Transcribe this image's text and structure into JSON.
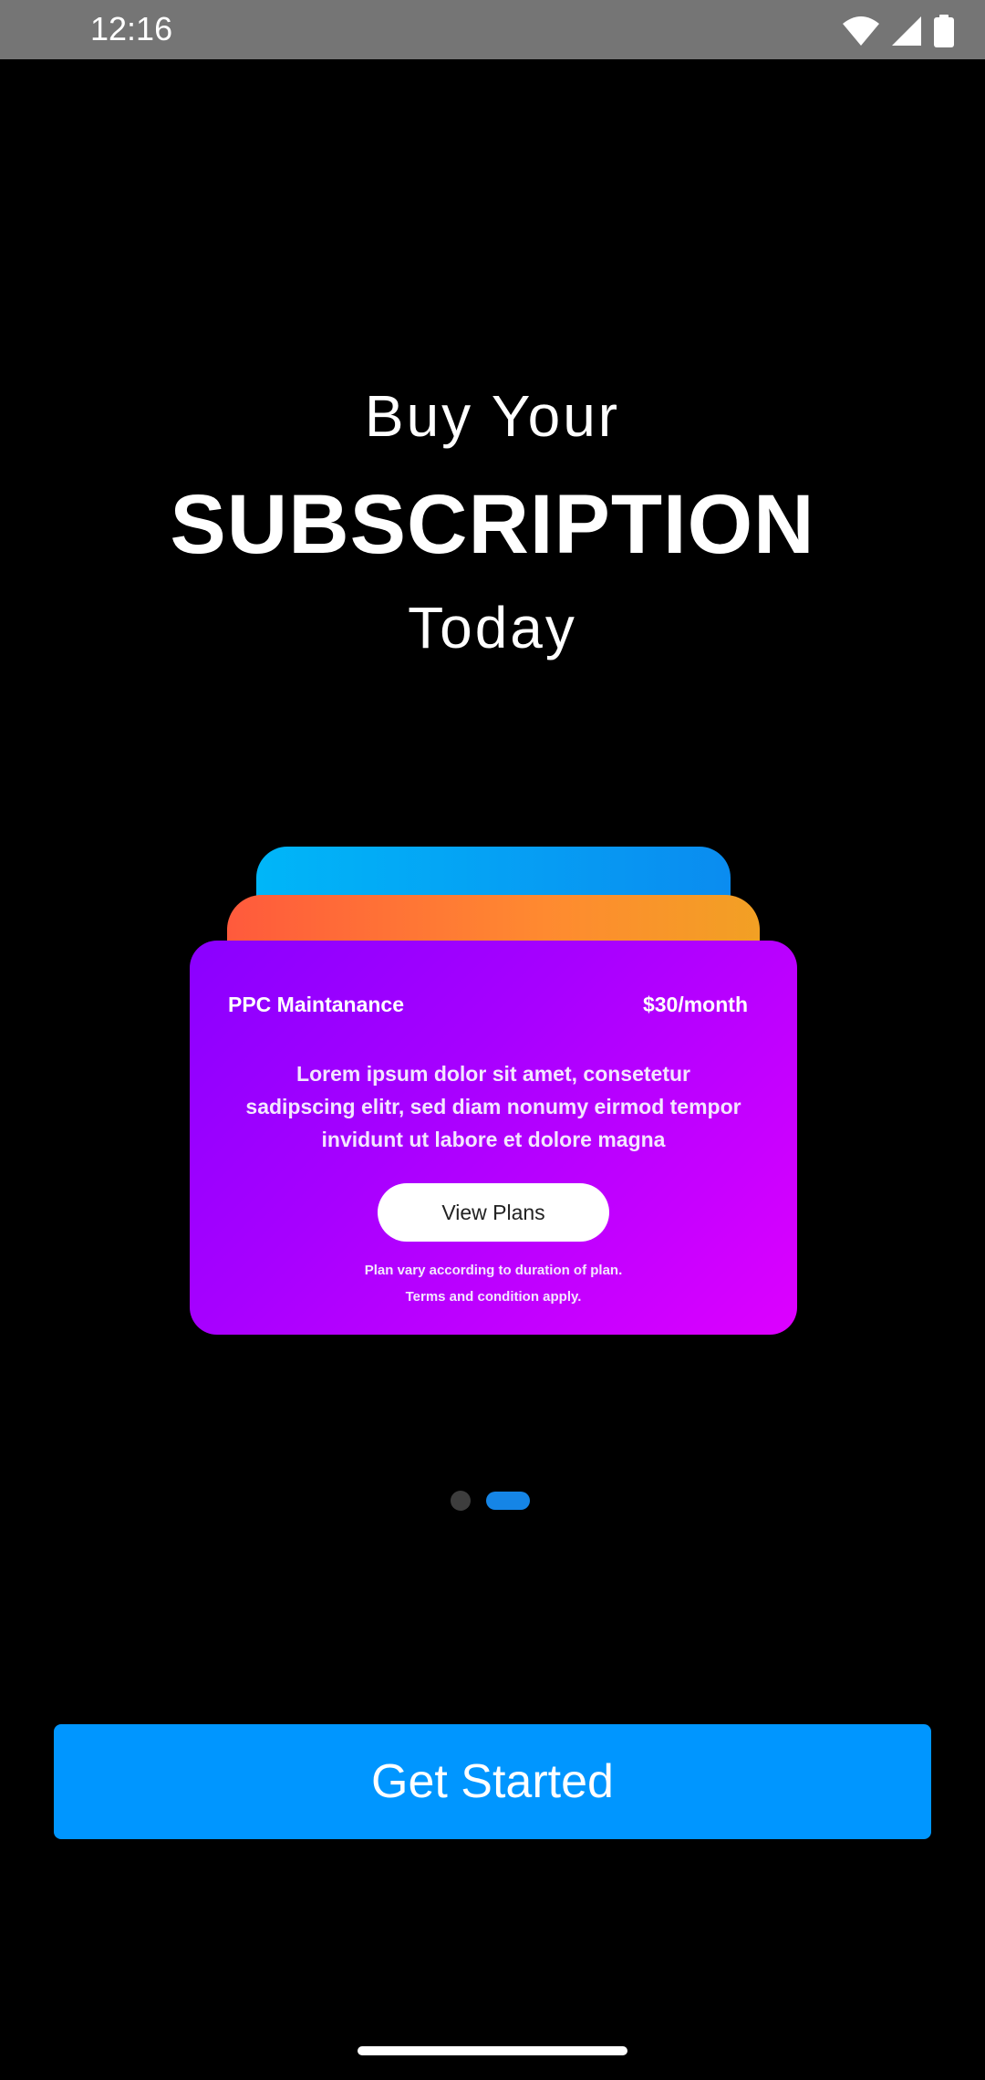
{
  "status_bar": {
    "time": "12:16",
    "icons": [
      "wifi-icon",
      "cellular-signal-icon",
      "battery-icon"
    ],
    "background": "#757575"
  },
  "heading": {
    "line1": "Buy Your",
    "line2": "SUBSCRIPTION",
    "line3": "Today"
  },
  "card": {
    "title": "PPC Maintanance",
    "price": "$30/month",
    "description": "Lorem ipsum dolor sit amet, consetetur sadipscing elitr, sed diam nonumy eirmod tempor invidunt ut labore et dolore magna",
    "button_label": "View Plans",
    "note_line1": "Plan vary according to duration of plan.",
    "note_line2": "Terms and condition apply."
  },
  "pager": {
    "pages": 2,
    "active_index": 1
  },
  "cta": {
    "label": "Get Started",
    "color": "#0096ff"
  },
  "colors": {
    "background": "#000000",
    "card_front_gradient": [
      "#8a00ff",
      "#dd00ff"
    ],
    "card_middle_gradient": [
      "#ff5a3c",
      "#f2a024"
    ],
    "card_back_gradient": [
      "#00b6f8",
      "#0a8cf0"
    ],
    "pager_active": "#1585e6",
    "pager_inactive": "#3d3d3d"
  }
}
